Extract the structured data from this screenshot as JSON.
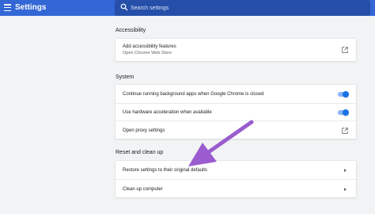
{
  "header": {
    "title": "Settings",
    "search_placeholder": "Search settings",
    "menu_icon": "hamburger-menu-icon",
    "search_icon": "search-icon",
    "bar_color": "#3367d6"
  },
  "sections": {
    "accessibility": {
      "title": "Accessibility",
      "add_features_label": "Add accessibility features",
      "add_features_sub": "Open Chrome Web Store"
    },
    "system": {
      "title": "System",
      "background_apps_label": "Continue running background apps when Google Chrome is closed",
      "background_apps_on": true,
      "hw_accel_label": "Use hardware acceleration when available",
      "hw_accel_on": true,
      "proxy_label": "Open proxy settings"
    },
    "reset": {
      "title": "Reset and clean up",
      "restore_label": "Restore settings to their original defaults",
      "cleanup_label": "Clean up computer"
    }
  },
  "annotation": {
    "arrow_color": "#9b5ccf"
  },
  "accent_color": "#1a73e8"
}
